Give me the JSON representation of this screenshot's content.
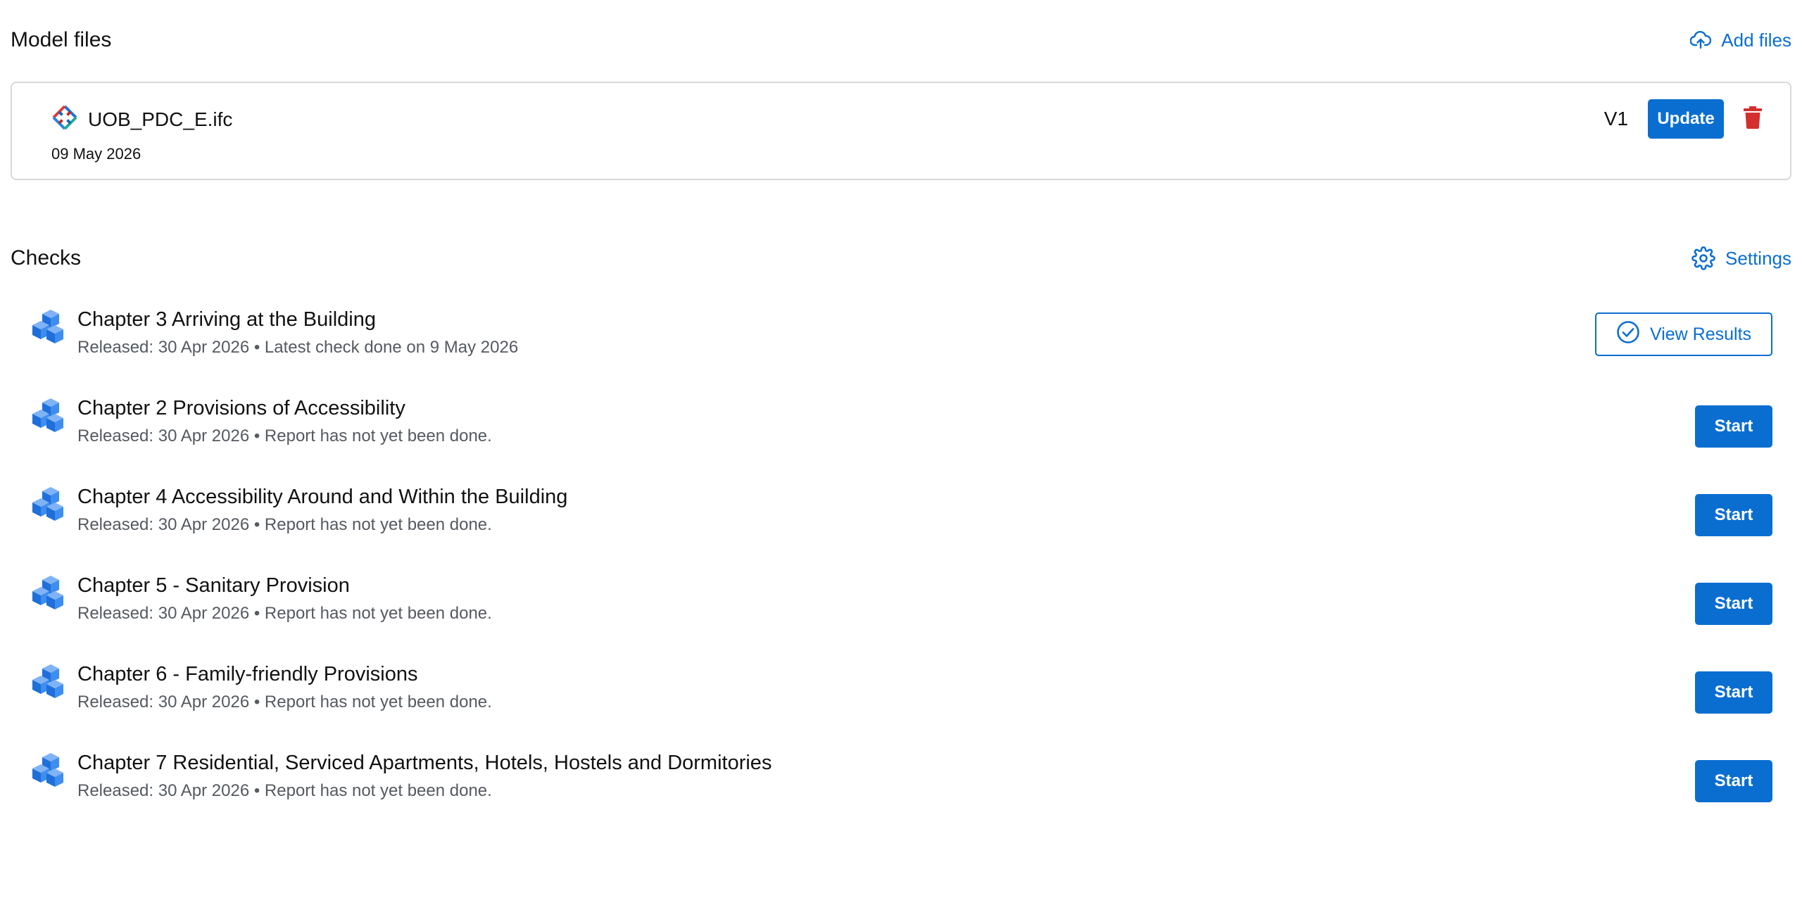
{
  "model_files": {
    "title": "Model files",
    "add_files_label": "Add files",
    "file": {
      "name": "UOB_PDC_E.ifc",
      "date": "09 May 2026",
      "version": "V1",
      "update_label": "Update"
    }
  },
  "checks": {
    "title": "Checks",
    "settings_label": "Settings",
    "items": [
      {
        "title": "Chapter 3 Arriving at the Building",
        "subtitle": "Released: 30 Apr 2026 • Latest check done on 9 May 2026",
        "action": "View Results"
      },
      {
        "title": "Chapter 2 Provisions of Accessibility",
        "subtitle": "Released: 30 Apr 2026 • Report has not yet been done.",
        "action": "Start"
      },
      {
        "title": "Chapter 4 Accessibility Around and Within the Building",
        "subtitle": "Released: 30 Apr 2026 • Report has not yet been done.",
        "action": "Start"
      },
      {
        "title": "Chapter 5 - Sanitary Provision",
        "subtitle": "Released: 30 Apr 2026 • Report has not yet been done.",
        "action": "Start"
      },
      {
        "title": "Chapter 6 - Family-friendly Provisions",
        "subtitle": "Released: 30 Apr 2026 • Report has not yet been done.",
        "action": "Start"
      },
      {
        "title": "Chapter 7 Residential, Serviced Apartments, Hotels, Hostels and Dormitories",
        "subtitle": "Released: 30 Apr 2026 • Report has not yet been done.",
        "action": "Start"
      }
    ]
  },
  "colors": {
    "accent": "#0a6ed1",
    "danger": "#d32f2f",
    "muted_text": "#555a60"
  },
  "icons": {
    "add_files": "cloud-upload-icon",
    "settings": "gear-icon",
    "file_type": "ifc-file-icon",
    "delete": "trash-icon",
    "check_item": "cube-stack-icon",
    "view_results": "check-circle-icon"
  }
}
